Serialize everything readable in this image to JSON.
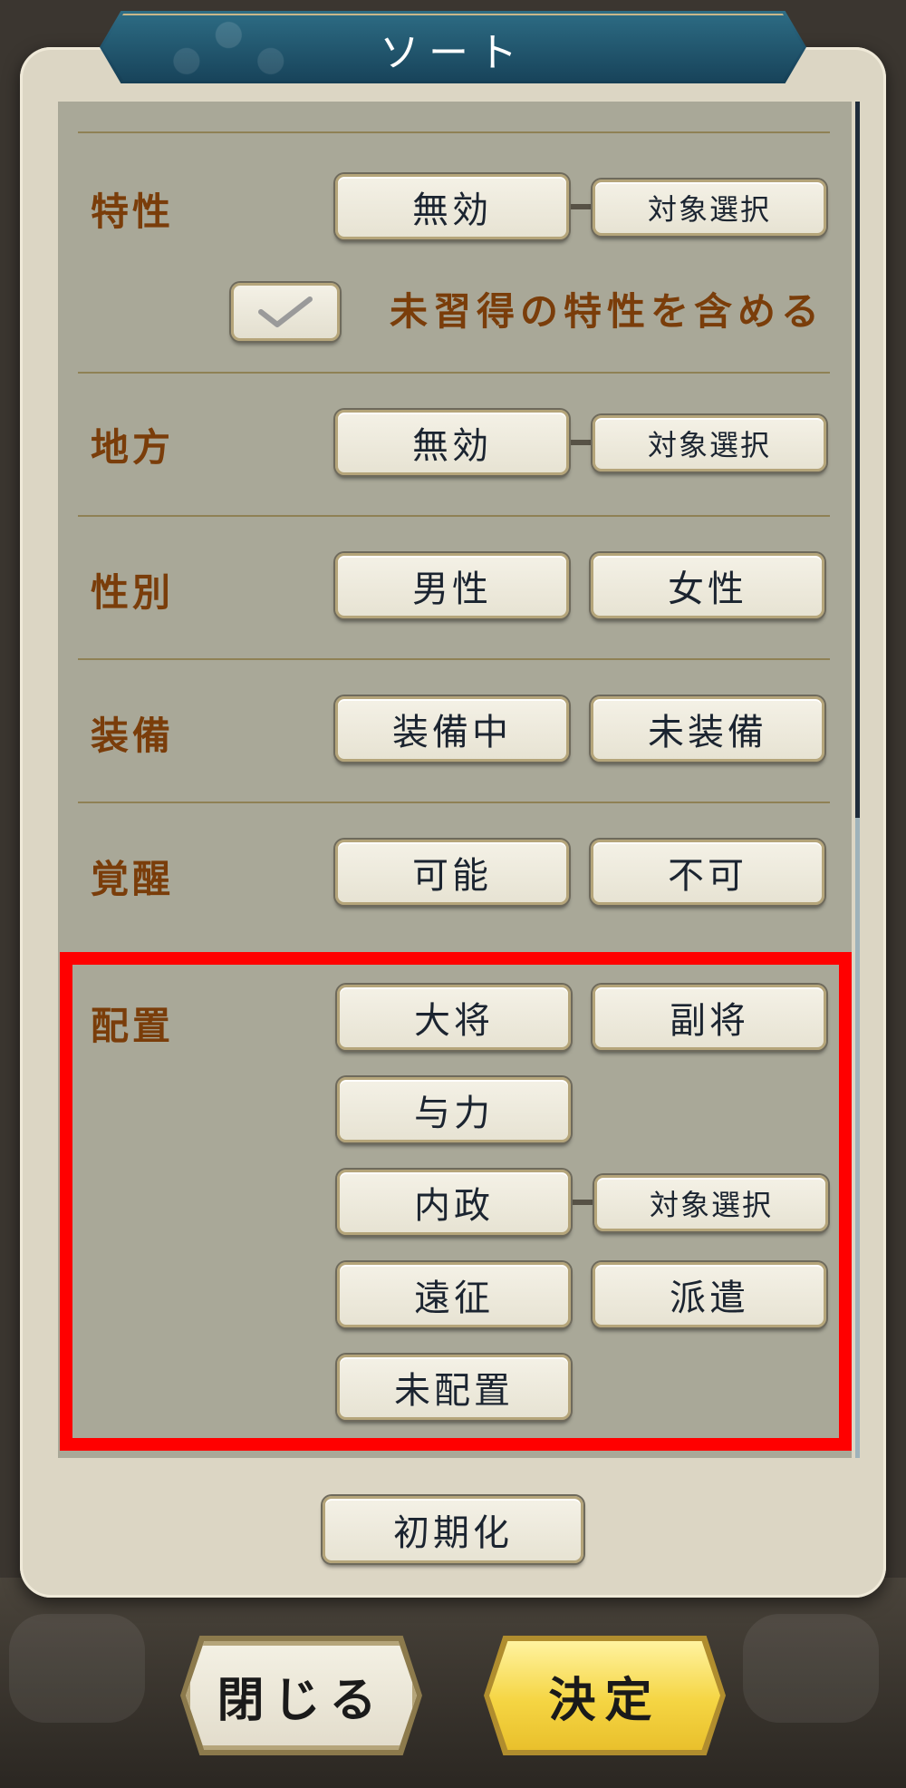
{
  "dialog": {
    "title": "ソート"
  },
  "sections": {
    "trait": {
      "label": "特性",
      "buttons": [
        "無効",
        "対象選択"
      ],
      "checkbox_label": "未習得の特性を含める",
      "checkbox_checked": true
    },
    "region": {
      "label": "地方",
      "buttons": [
        "無効",
        "対象選択"
      ]
    },
    "gender": {
      "label": "性別",
      "buttons": [
        "男性",
        "女性"
      ]
    },
    "equipment": {
      "label": "装備",
      "buttons": [
        "装備中",
        "未装備"
      ]
    },
    "awakening": {
      "label": "覚醒",
      "buttons": [
        "可能",
        "不可"
      ]
    },
    "placement": {
      "label": "配置",
      "buttons": [
        "大将",
        "副将",
        "与力",
        "内政",
        "対象選択",
        "遠征",
        "派遣",
        "未配置"
      ]
    }
  },
  "reset_button": "初期化",
  "footer": {
    "close": "閉じる",
    "confirm": "決定"
  },
  "colors": {
    "highlight": "#ff0000",
    "label_text": "#7a3d0a",
    "panel_bg": "#a9a898",
    "title_bg": "#1d4d66",
    "confirm_bg": "#f5d543"
  },
  "icons": [
    "check-icon"
  ]
}
